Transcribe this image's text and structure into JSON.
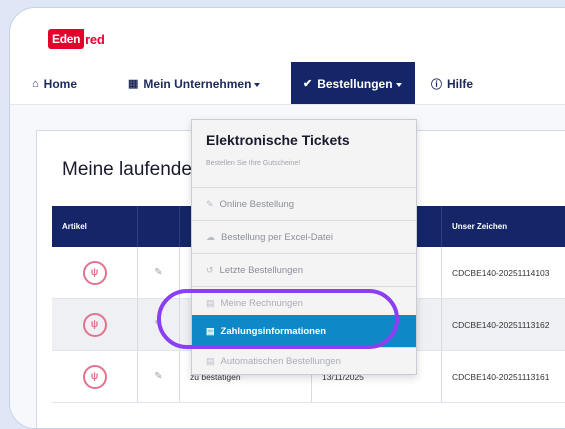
{
  "brand": {
    "logo_boxed": "Eden",
    "logo_rest": "red",
    "accent": "#e4002b"
  },
  "nav": {
    "home": {
      "icon": "home-icon",
      "label": "Home"
    },
    "company": {
      "icon": "building-icon",
      "label": "Mein Unternehmen"
    },
    "orders": {
      "icon": "check-circle-icon",
      "label": "Bestellungen"
    },
    "help": {
      "icon": "info-icon",
      "label": "Hilfe"
    }
  },
  "page": {
    "title": "Meine laufenden"
  },
  "table": {
    "columns": [
      "Artikel",
      "",
      "",
      "",
      "Unser Zeichen"
    ],
    "rows": [
      {
        "status": "",
        "date": "",
        "ref": "CDCBE140-20251114103"
      },
      {
        "status": "",
        "date": "",
        "ref": "CDCBE140-20251113162"
      },
      {
        "status": "zu bestätigen",
        "date": "13/11/2025",
        "ref": "CDCBE140-20251113161"
      }
    ]
  },
  "dropdown": {
    "title": "Elektronische Tickets",
    "subtitle": "Bestellen Sie Ihre Gutscheine!",
    "items": [
      {
        "icon": "edit-icon",
        "label": "Online Bestellung"
      },
      {
        "icon": "cloud-upload-icon",
        "label": "Bestellung per Excel-Datei"
      },
      {
        "icon": "history-icon",
        "label": "Letzte Bestellungen"
      },
      {
        "icon": "document-icon",
        "label": "Meine Rechnungen"
      },
      {
        "icon": "document-icon",
        "label": "Zahlungsinformationen"
      },
      {
        "icon": "document-icon",
        "label": "Automatischen Bestellungen"
      }
    ]
  },
  "colors": {
    "nav_active": "#142668",
    "menu_active": "#0f88c7",
    "highlight": "#8a3ff0"
  }
}
